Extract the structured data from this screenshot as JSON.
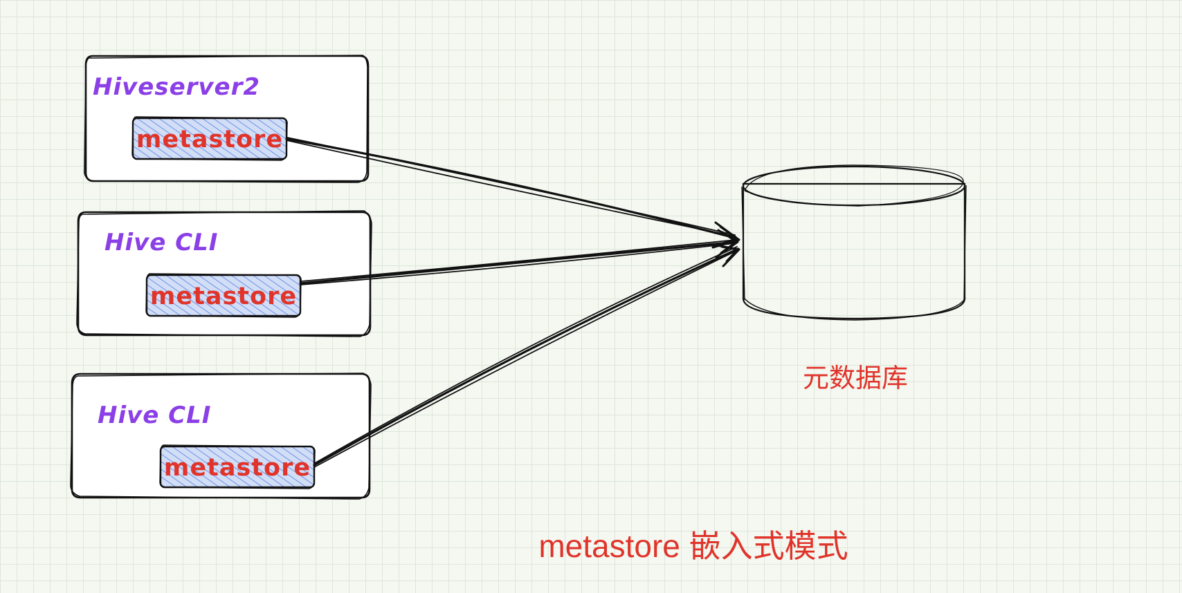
{
  "colors": {
    "ink": "#111111",
    "component_label": "#8b3fe6",
    "metastore_label": "#e0342b",
    "hatch": "#3f74e0",
    "hatch_fill": "#d2ddf6",
    "box_fill": "#ffffff",
    "database_label": "#e0342b",
    "caption": "#e0342b"
  },
  "components": [
    {
      "label": "Hiveserver2",
      "metastore_label": "metastore"
    },
    {
      "label": "Hive CLI",
      "metastore_label": "metastore"
    },
    {
      "label": "Hive CLI",
      "metastore_label": "metastore"
    }
  ],
  "database": {
    "label": "元数据库",
    "icon": "database-cylinder-icon"
  },
  "caption": "metastore 嵌入式模式"
}
